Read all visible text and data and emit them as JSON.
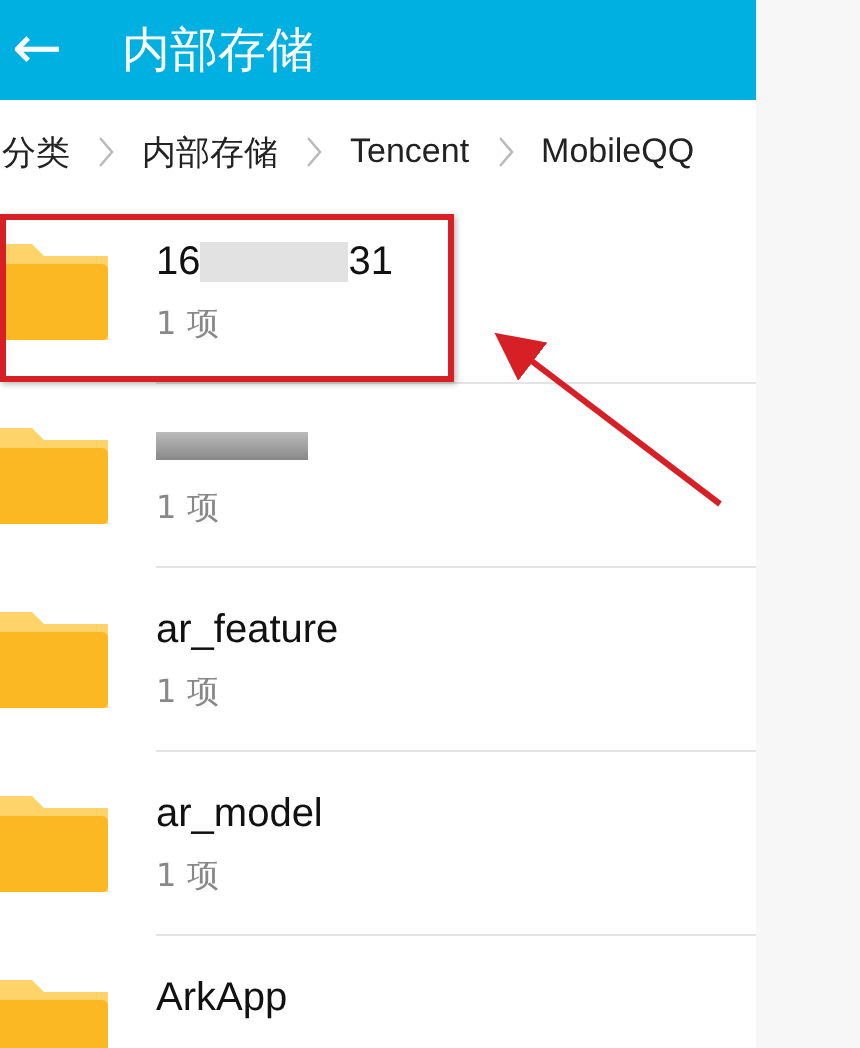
{
  "app_bar": {
    "back_icon": "←",
    "title": "内部存储"
  },
  "breadcrumbs": [
    {
      "label": "分类"
    },
    {
      "label": "内部存储"
    },
    {
      "label": "Tencent"
    },
    {
      "label": "MobileQQ"
    }
  ],
  "folders": [
    {
      "name_parts": [
        "16",
        "31"
      ],
      "redacted": true,
      "count": "1 项",
      "highlighted": true
    },
    {
      "redacted": true,
      "count": "1 项",
      "highlighted": false
    },
    {
      "name_parts": [
        "ar_feature"
      ],
      "redacted": false,
      "count": "1 项",
      "highlighted": false
    },
    {
      "name_parts": [
        "ar_model"
      ],
      "redacted": false,
      "count": "1 项",
      "highlighted": false
    },
    {
      "name_parts": [
        "ArkApp"
      ],
      "redacted": false,
      "highlighted": false
    }
  ]
}
